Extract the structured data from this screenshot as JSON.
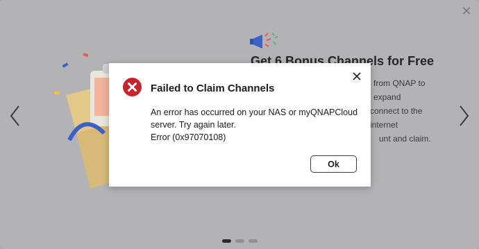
{
  "promo": {
    "title": "Get 6 Bonus Channels for Free",
    "description_lines": [
      "from QNAP to expand",
      "connect to the internet",
      "unt and claim."
    ],
    "close_icon": "close-icon",
    "prev_icon": "chevron-left-icon",
    "next_icon": "chevron-right-icon",
    "pager": {
      "total": 3,
      "active": 1
    }
  },
  "dialog": {
    "title": "Failed to Claim Channels",
    "message_lines": [
      "An error has occurred on your NAS or myQNAPCloud",
      "server. Try again later.",
      "Error (0x97070108)"
    ],
    "ok_label": "Ok",
    "icon": "error-icon",
    "close_icon": "close-icon"
  },
  "colors": {
    "error_red": "#c8232c",
    "backdrop": "#b3b3b5",
    "dialog_bg": "#ffffff",
    "accent_blue": "#3a62c9"
  }
}
